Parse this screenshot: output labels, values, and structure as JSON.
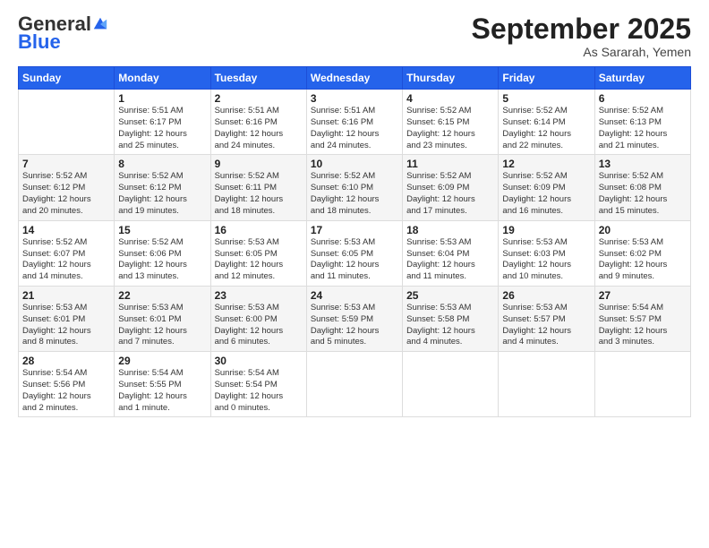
{
  "logo": {
    "general": "General",
    "blue": "Blue"
  },
  "header": {
    "month": "September 2025",
    "location": "As Sararah, Yemen"
  },
  "days_of_week": [
    "Sunday",
    "Monday",
    "Tuesday",
    "Wednesday",
    "Thursday",
    "Friday",
    "Saturday"
  ],
  "weeks": [
    [
      {
        "day": "",
        "info": ""
      },
      {
        "day": "1",
        "info": "Sunrise: 5:51 AM\nSunset: 6:17 PM\nDaylight: 12 hours\nand 25 minutes."
      },
      {
        "day": "2",
        "info": "Sunrise: 5:51 AM\nSunset: 6:16 PM\nDaylight: 12 hours\nand 24 minutes."
      },
      {
        "day": "3",
        "info": "Sunrise: 5:51 AM\nSunset: 6:16 PM\nDaylight: 12 hours\nand 24 minutes."
      },
      {
        "day": "4",
        "info": "Sunrise: 5:52 AM\nSunset: 6:15 PM\nDaylight: 12 hours\nand 23 minutes."
      },
      {
        "day": "5",
        "info": "Sunrise: 5:52 AM\nSunset: 6:14 PM\nDaylight: 12 hours\nand 22 minutes."
      },
      {
        "day": "6",
        "info": "Sunrise: 5:52 AM\nSunset: 6:13 PM\nDaylight: 12 hours\nand 21 minutes."
      }
    ],
    [
      {
        "day": "7",
        "info": "Sunrise: 5:52 AM\nSunset: 6:12 PM\nDaylight: 12 hours\nand 20 minutes."
      },
      {
        "day": "8",
        "info": "Sunrise: 5:52 AM\nSunset: 6:12 PM\nDaylight: 12 hours\nand 19 minutes."
      },
      {
        "day": "9",
        "info": "Sunrise: 5:52 AM\nSunset: 6:11 PM\nDaylight: 12 hours\nand 18 minutes."
      },
      {
        "day": "10",
        "info": "Sunrise: 5:52 AM\nSunset: 6:10 PM\nDaylight: 12 hours\nand 18 minutes."
      },
      {
        "day": "11",
        "info": "Sunrise: 5:52 AM\nSunset: 6:09 PM\nDaylight: 12 hours\nand 17 minutes."
      },
      {
        "day": "12",
        "info": "Sunrise: 5:52 AM\nSunset: 6:09 PM\nDaylight: 12 hours\nand 16 minutes."
      },
      {
        "day": "13",
        "info": "Sunrise: 5:52 AM\nSunset: 6:08 PM\nDaylight: 12 hours\nand 15 minutes."
      }
    ],
    [
      {
        "day": "14",
        "info": "Sunrise: 5:52 AM\nSunset: 6:07 PM\nDaylight: 12 hours\nand 14 minutes."
      },
      {
        "day": "15",
        "info": "Sunrise: 5:52 AM\nSunset: 6:06 PM\nDaylight: 12 hours\nand 13 minutes."
      },
      {
        "day": "16",
        "info": "Sunrise: 5:53 AM\nSunset: 6:05 PM\nDaylight: 12 hours\nand 12 minutes."
      },
      {
        "day": "17",
        "info": "Sunrise: 5:53 AM\nSunset: 6:05 PM\nDaylight: 12 hours\nand 11 minutes."
      },
      {
        "day": "18",
        "info": "Sunrise: 5:53 AM\nSunset: 6:04 PM\nDaylight: 12 hours\nand 11 minutes."
      },
      {
        "day": "19",
        "info": "Sunrise: 5:53 AM\nSunset: 6:03 PM\nDaylight: 12 hours\nand 10 minutes."
      },
      {
        "day": "20",
        "info": "Sunrise: 5:53 AM\nSunset: 6:02 PM\nDaylight: 12 hours\nand 9 minutes."
      }
    ],
    [
      {
        "day": "21",
        "info": "Sunrise: 5:53 AM\nSunset: 6:01 PM\nDaylight: 12 hours\nand 8 minutes."
      },
      {
        "day": "22",
        "info": "Sunrise: 5:53 AM\nSunset: 6:01 PM\nDaylight: 12 hours\nand 7 minutes."
      },
      {
        "day": "23",
        "info": "Sunrise: 5:53 AM\nSunset: 6:00 PM\nDaylight: 12 hours\nand 6 minutes."
      },
      {
        "day": "24",
        "info": "Sunrise: 5:53 AM\nSunset: 5:59 PM\nDaylight: 12 hours\nand 5 minutes."
      },
      {
        "day": "25",
        "info": "Sunrise: 5:53 AM\nSunset: 5:58 PM\nDaylight: 12 hours\nand 4 minutes."
      },
      {
        "day": "26",
        "info": "Sunrise: 5:53 AM\nSunset: 5:57 PM\nDaylight: 12 hours\nand 4 minutes."
      },
      {
        "day": "27",
        "info": "Sunrise: 5:54 AM\nSunset: 5:57 PM\nDaylight: 12 hours\nand 3 minutes."
      }
    ],
    [
      {
        "day": "28",
        "info": "Sunrise: 5:54 AM\nSunset: 5:56 PM\nDaylight: 12 hours\nand 2 minutes."
      },
      {
        "day": "29",
        "info": "Sunrise: 5:54 AM\nSunset: 5:55 PM\nDaylight: 12 hours\nand 1 minute."
      },
      {
        "day": "30",
        "info": "Sunrise: 5:54 AM\nSunset: 5:54 PM\nDaylight: 12 hours\nand 0 minutes."
      },
      {
        "day": "",
        "info": ""
      },
      {
        "day": "",
        "info": ""
      },
      {
        "day": "",
        "info": ""
      },
      {
        "day": "",
        "info": ""
      }
    ]
  ]
}
